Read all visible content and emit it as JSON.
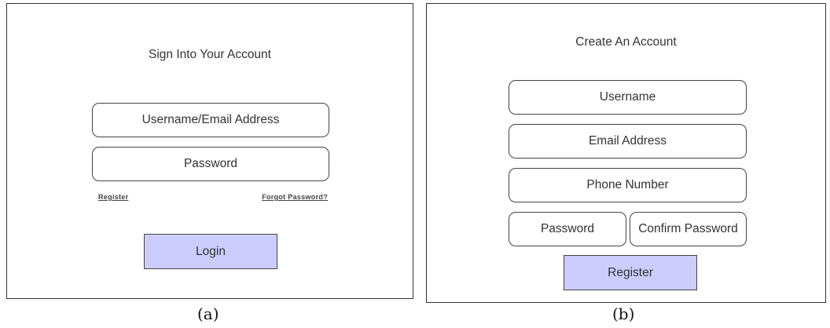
{
  "login": {
    "title": "Sign Into Your Account",
    "username_field": "Username/Email Address",
    "password_field": "Password",
    "register_link": "Register",
    "forgot_link": "Forgot Password?",
    "login_button": "Login",
    "button_color": "#ccccff"
  },
  "register": {
    "title": "Create An Account",
    "username_field": "Username",
    "email_field": "Email Address",
    "phone_field": "Phone Number",
    "password_field": "Password",
    "confirm_password_field": "Confirm Password",
    "register_button": "Register",
    "button_color": "#ccccff"
  },
  "captions": {
    "a": "(a)",
    "b": "(b)"
  }
}
